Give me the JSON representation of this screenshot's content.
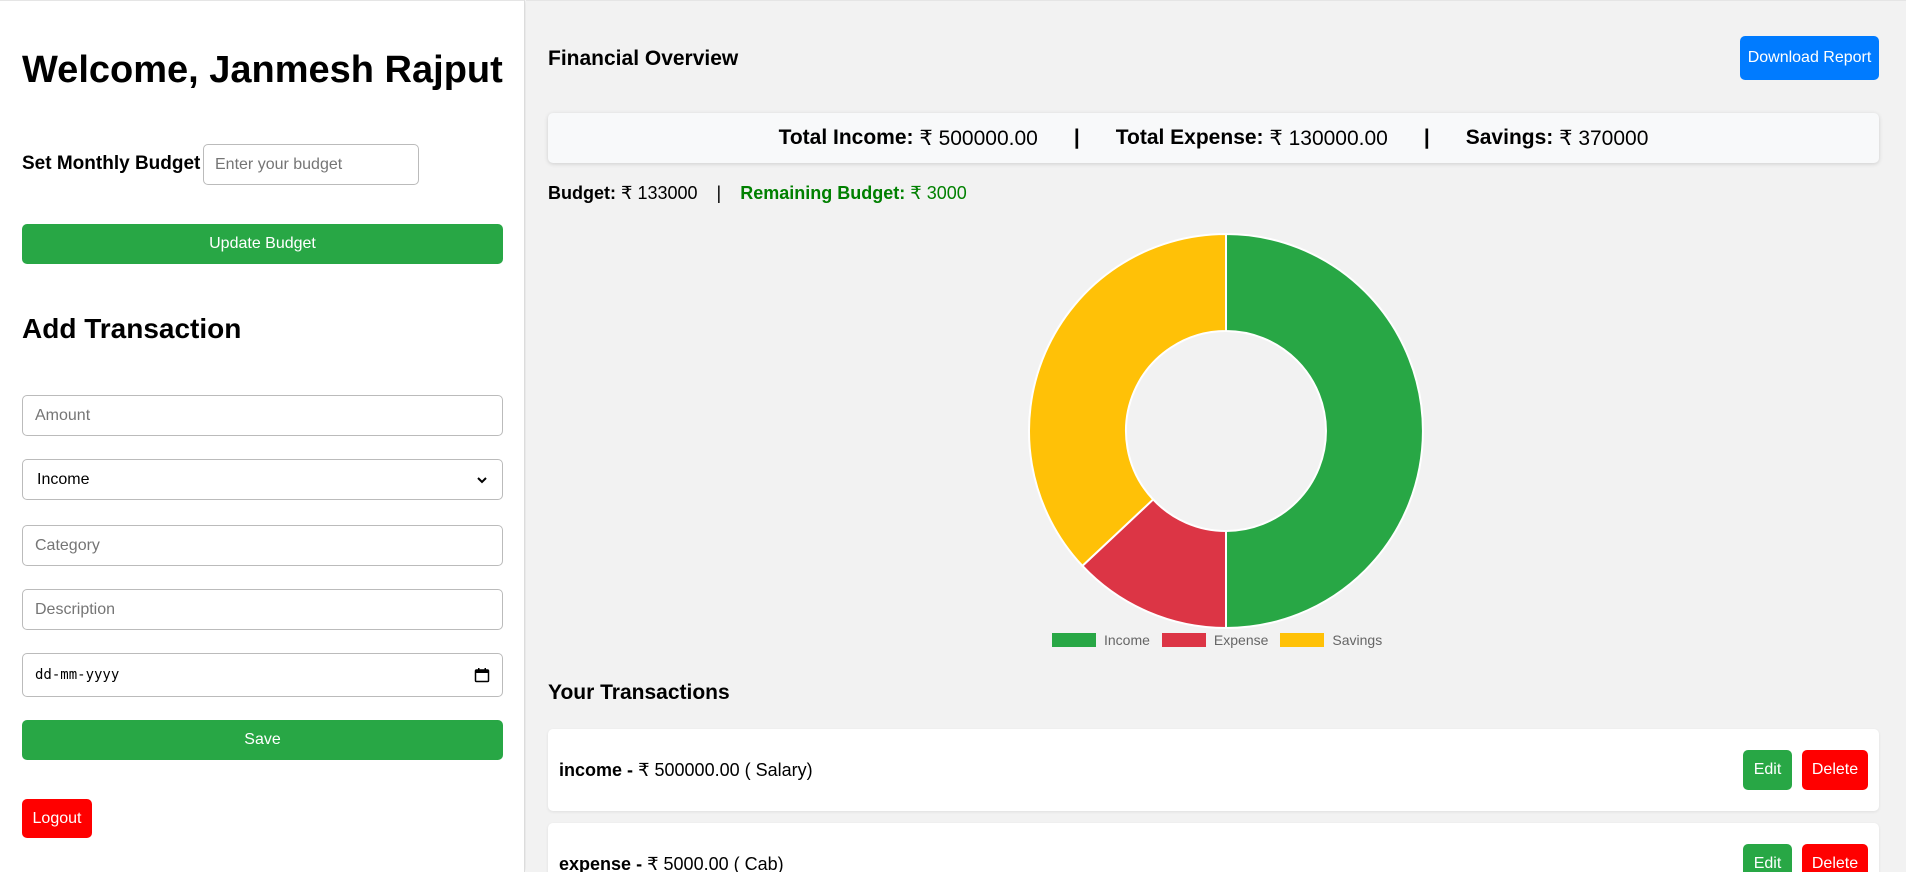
{
  "sidebar": {
    "welcome": "Welcome, Janmesh Rajput",
    "budget_label": "Set Monthly Budget",
    "budget_placeholder": "Enter your budget",
    "update_budget_label": "Update Budget",
    "add_transaction_heading": "Add Transaction",
    "amount_placeholder": "Amount",
    "type_selected": "Income",
    "category_placeholder": "Category",
    "description_placeholder": "Description",
    "date_placeholder": "dd-mm-yyyy",
    "save_label": "Save",
    "logout_label": "Logout"
  },
  "overview": {
    "title": "Financial Overview",
    "download_label": "Download Report",
    "total_income_label": "Total Income:",
    "total_income_value": "₹ 500000.00",
    "total_expense_label": "Total Expense:",
    "total_expense_value": "₹ 130000.00",
    "savings_label": "Savings:",
    "savings_value": "₹ 370000",
    "separator": "|",
    "budget_label": "Budget:",
    "budget_value": "₹ 133000",
    "remaining_label": "Remaining Budget:",
    "remaining_value": "₹ 3000"
  },
  "chart_data": {
    "type": "pie",
    "donut": true,
    "categories": [
      "Income",
      "Expense",
      "Savings"
    ],
    "values": [
      500000,
      130000,
      370000
    ],
    "colors": [
      "#28a745",
      "#dc3545",
      "#ffc107"
    ],
    "legend_position": "bottom"
  },
  "transactions": {
    "title": "Your Transactions",
    "edit_label": "Edit",
    "delete_label": "Delete",
    "items": [
      {
        "type": "income",
        "sep": "-",
        "amount": "₹ 500000.00",
        "category": "( Salary)"
      },
      {
        "type": "expense",
        "sep": "-",
        "amount": "₹ 5000.00",
        "category": "( Cab)"
      }
    ]
  },
  "colors": {
    "green": "#28a745",
    "red": "#ff0000",
    "blue": "#007bff",
    "remaining_green": "#008000"
  }
}
